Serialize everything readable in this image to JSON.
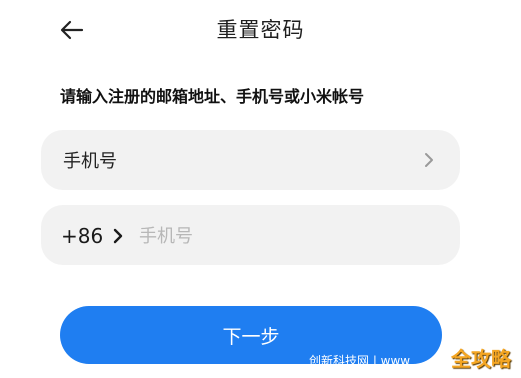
{
  "header": {
    "title": "重置密码"
  },
  "instruction": "请输入注册的邮箱地址、手机号或小米帐号",
  "account_field": {
    "label": "手机号"
  },
  "phone_field": {
    "country_code": "+86",
    "placeholder": "手机号"
  },
  "next_button": {
    "label": "下一步"
  },
  "watermark": {
    "text": "创新科技网 | www",
    "logo": "全攻略"
  },
  "colors": {
    "accent": "#1f7ef1",
    "field_background": "#f2f2f2",
    "text": "#1f1f1f"
  },
  "icons": {
    "back": "arrow-left-icon",
    "chevron": "chevron-right-icon"
  }
}
